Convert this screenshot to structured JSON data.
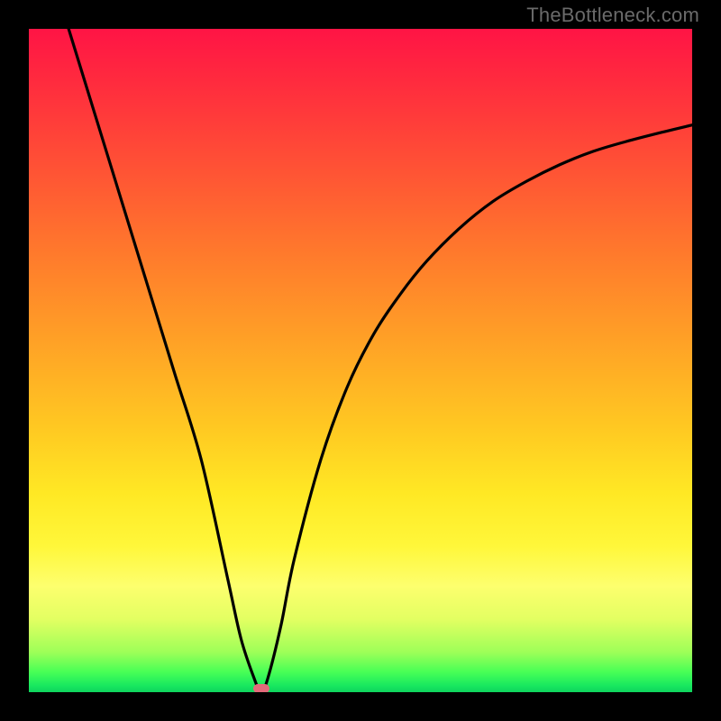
{
  "watermark": "TheBottleneck.com",
  "colors": {
    "gradient_top": "#ff1445",
    "gradient_mid1": "#ff7a2c",
    "gradient_mid2": "#ffe824",
    "gradient_bottom": "#0fd45e",
    "curve": "#000000",
    "frame": "#000000",
    "marker": "#e36a7a"
  },
  "chart_data": {
    "type": "line",
    "title": "",
    "xlabel": "",
    "ylabel": "",
    "xlim": [
      0,
      100
    ],
    "ylim": [
      0,
      100
    ],
    "grid": false,
    "series": [
      {
        "name": "bottleneck-curve",
        "x": [
          6,
          10,
          14,
          18,
          22,
          26,
          30,
          32,
          34,
          35,
          36,
          38,
          40,
          44,
          48,
          52,
          56,
          60,
          65,
          70,
          75,
          80,
          85,
          90,
          95,
          100
        ],
        "y": [
          100,
          87,
          74,
          61,
          48,
          35,
          17,
          8,
          2,
          0,
          2,
          10,
          20,
          35,
          46,
          54,
          60,
          65,
          70,
          74,
          77,
          79.5,
          81.5,
          83,
          84.3,
          85.5
        ]
      }
    ],
    "annotations": [
      {
        "name": "minimum-marker",
        "x": 35,
        "y": 0
      }
    ],
    "legend": false,
    "notes": "V-shaped bottleneck curve: steep linear descent from x≈6 to a minimum at x≈35, then a decelerating rise toward ~85% at x=100. Background is a vertical red→green heat gradient."
  }
}
